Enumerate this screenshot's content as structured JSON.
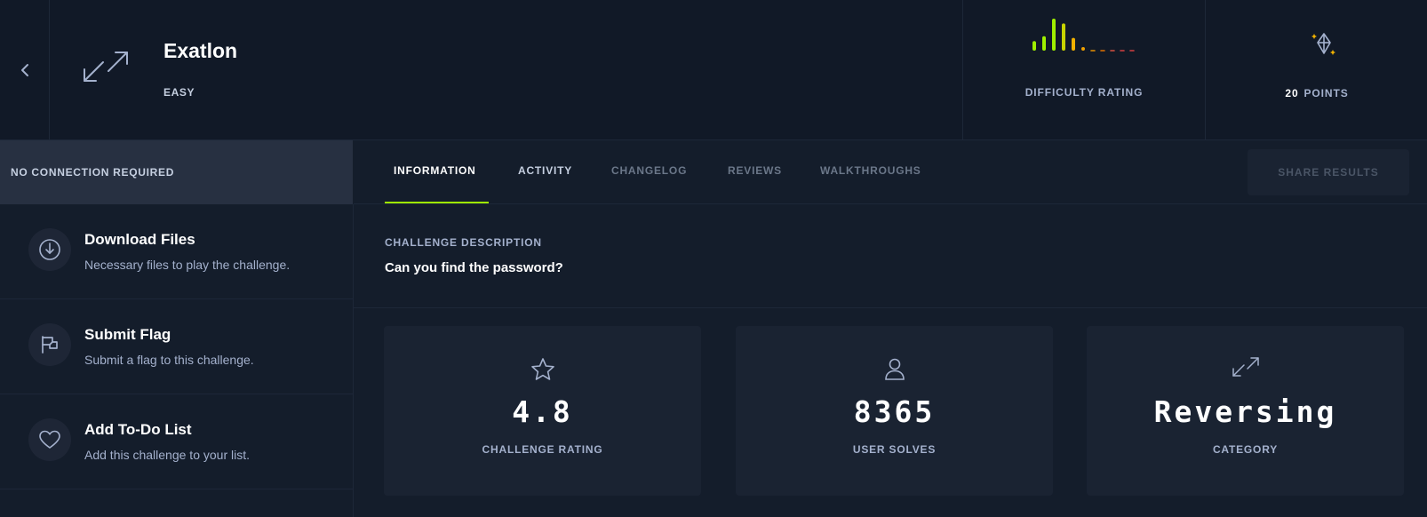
{
  "challenge": {
    "name": "Exatlon",
    "difficulty": "EASY",
    "category_icon": "reversing-arrows-icon"
  },
  "difficulty_rating": {
    "label": "DIFFICULTY RATING",
    "bar_colors": [
      "#9fef00",
      "#9fef00",
      "#9fef00",
      "#c8d400",
      "#f0b100",
      "#f0a000",
      "#e89000",
      "#e07000",
      "#d45040",
      "#d44040",
      "#d44040"
    ],
    "bar_levels": [
      0.3,
      0.45,
      1.0,
      0.85,
      0.4,
      0.1,
      0.05,
      0.05,
      0.05,
      0.05,
      0.05
    ]
  },
  "points": {
    "value": "20",
    "label": "POINTS",
    "icon": "diamond-sparkle-icon"
  },
  "connection": {
    "label": "NO CONNECTION REQUIRED"
  },
  "actions": [
    {
      "title": "Download Files",
      "subtitle": "Necessary files to play the challenge.",
      "icon": "download-icon"
    },
    {
      "title": "Submit Flag",
      "subtitle": "Submit a flag to this challenge.",
      "icon": "flag-icon"
    },
    {
      "title": "Add To-Do List",
      "subtitle": "Add this challenge to your list.",
      "icon": "heart-icon"
    }
  ],
  "tabs": [
    {
      "label": "INFORMATION",
      "state": "active"
    },
    {
      "label": "ACTIVITY",
      "state": "normal"
    },
    {
      "label": "CHANGELOG",
      "state": "dim"
    },
    {
      "label": "REVIEWS",
      "state": "dim"
    },
    {
      "label": "WALKTHROUGHS",
      "state": "dim"
    }
  ],
  "share_button": "SHARE RESULTS",
  "description": {
    "label": "CHALLENGE DESCRIPTION",
    "text": "Can you find the password?"
  },
  "stats": [
    {
      "value": "4.8",
      "label": "CHALLENGE RATING",
      "icon": "star-icon"
    },
    {
      "value": "8365",
      "label": "USER SOLVES",
      "icon": "user-icon"
    },
    {
      "value": "Reversing",
      "label": "CATEGORY",
      "icon": "reversing-arrows-icon"
    }
  ],
  "colors": {
    "accent": "#9fef00",
    "bg": "#141d2b",
    "header_bg": "#111927",
    "card_bg": "#1a2332",
    "muted_text": "#a4b1cd"
  }
}
